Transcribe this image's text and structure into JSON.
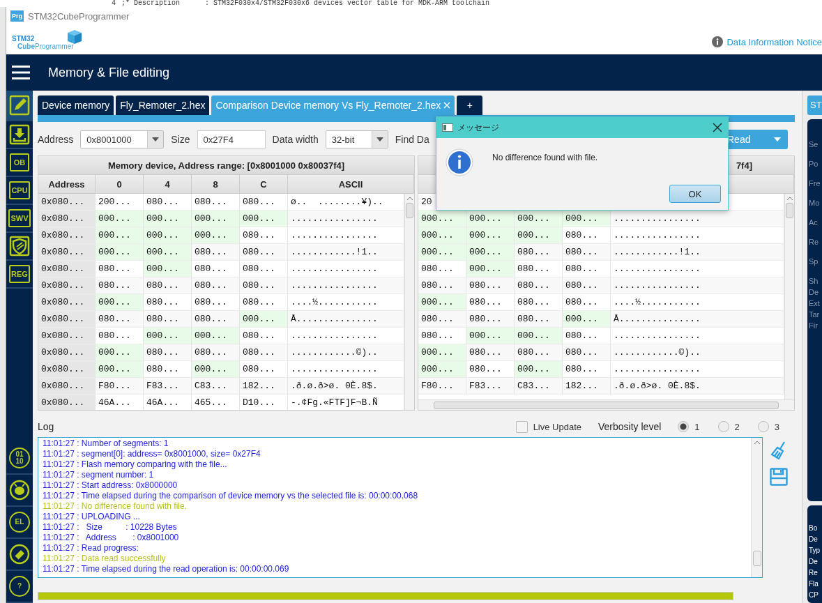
{
  "background_editor": {
    "line_number": "4",
    "text": ";* Description      : STM32F030x4/STM32F030x6 devices vector table for MDK-ARM toolchain"
  },
  "window": {
    "title": "STM32CubeProgrammer",
    "app_icon_label": "Prg"
  },
  "logo": {
    "brand": "STM32",
    "product": "**Cube**Programmer"
  },
  "notice_link": "Data Information Notice",
  "header": {
    "title": "Memory & File editing"
  },
  "sidebar": {
    "top_items": [
      {
        "kind": "edit",
        "selected": true
      },
      {
        "kind": "download",
        "selected": false
      },
      {
        "kind": "tag",
        "lines": [
          "OB"
        ],
        "selected": false
      },
      {
        "kind": "tag",
        "lines": [
          "CPU"
        ],
        "selected": false
      },
      {
        "kind": "tag",
        "lines": [
          "SWV"
        ],
        "selected": false
      },
      {
        "kind": "shield",
        "selected": false
      },
      {
        "kind": "tag",
        "lines": [
          "REG"
        ],
        "selected": false
      }
    ],
    "bottom_items": [
      {
        "kind": "circle",
        "lines": [
          "01",
          "10"
        ],
        "selected": false
      },
      {
        "kind": "bug",
        "selected": false
      },
      {
        "kind": "circle",
        "lines": [
          "EL"
        ],
        "selected": false
      },
      {
        "kind": "eraser",
        "selected": false
      },
      {
        "kind": "circle",
        "lines": [
          "?"
        ],
        "selected": false
      }
    ]
  },
  "tabs": [
    {
      "label": "Device memory",
      "selected": false,
      "closable": false
    },
    {
      "label": "Fly_Remoter_2.hex",
      "selected": false,
      "closable": false
    },
    {
      "label": "Comparison Device memory Vs Fly_Remoter_2.hex",
      "selected": true,
      "closable": true
    }
  ],
  "add_tab_label": "+",
  "toolbar": {
    "address_label": "Address",
    "address_value": "0x8001000",
    "size_label": "Size",
    "size_value": "0x27F4",
    "data_width_label": "Data width",
    "data_width_value": "32-bit",
    "find_label": "Find Da",
    "read_button": "Read"
  },
  "tables": [
    {
      "title": "Memory device, Address range: [0x8001000 0x80037f4]",
      "columns": [
        "Address",
        "0",
        "4",
        "8",
        "C",
        "ASCII"
      ],
      "rows": [
        {
          "address": "0x080...",
          "values": [
            "200...",
            "080...",
            "080...",
            "080..."
          ],
          "highlighted": [
            false,
            false,
            false,
            false
          ],
          "ascii": "ø..  ........¥).."
        },
        {
          "address": "0x080...",
          "values": [
            "000...",
            "000...",
            "000...",
            "000..."
          ],
          "highlighted": [
            true,
            true,
            true,
            true
          ],
          "ascii": "................"
        },
        {
          "address": "0x080...",
          "values": [
            "000...",
            "000...",
            "000...",
            "080..."
          ],
          "highlighted": [
            true,
            true,
            true,
            false
          ],
          "ascii": "................"
        },
        {
          "address": "0x080...",
          "values": [
            "000...",
            "000...",
            "080...",
            "080..."
          ],
          "highlighted": [
            true,
            true,
            false,
            false
          ],
          "ascii": "............!1.."
        },
        {
          "address": "0x080...",
          "values": [
            "080...",
            "000...",
            "080...",
            "080..."
          ],
          "highlighted": [
            false,
            true,
            false,
            false
          ],
          "ascii": "................"
        },
        {
          "address": "0x080...",
          "values": [
            "080...",
            "080...",
            "080...",
            "080..."
          ],
          "highlighted": [
            false,
            false,
            false,
            false
          ],
          "ascii": "................"
        },
        {
          "address": "0x080...",
          "values": [
            "000...",
            "080...",
            "080...",
            "080..."
          ],
          "highlighted": [
            true,
            false,
            false,
            false
          ],
          "ascii": "....½..........."
        },
        {
          "address": "0x080...",
          "values": [
            "080...",
            "080...",
            "080...",
            "000..."
          ],
          "highlighted": [
            false,
            false,
            false,
            true
          ],
          "ascii": "Å..............."
        },
        {
          "address": "0x080...",
          "values": [
            "080...",
            "000...",
            "000...",
            "080..."
          ],
          "highlighted": [
            false,
            true,
            true,
            false
          ],
          "ascii": "................"
        },
        {
          "address": "0x080...",
          "values": [
            "000...",
            "080...",
            "080...",
            "080..."
          ],
          "highlighted": [
            true,
            false,
            false,
            false
          ],
          "ascii": "............©).."
        },
        {
          "address": "0x080...",
          "values": [
            "000...",
            "080...",
            "000...",
            "080..."
          ],
          "highlighted": [
            true,
            false,
            true,
            false
          ],
          "ascii": "................"
        },
        {
          "address": "0x080...",
          "values": [
            "F80...",
            "F83...",
            "C83...",
            "182..."
          ],
          "highlighted": [
            false,
            false,
            false,
            false
          ],
          "ascii": ".ð.ø.ð>ø. 0È.8$."
        },
        {
          "address": "0x080...",
          "values": [
            "46A...",
            "46A...",
            "465...",
            "D10..."
          ],
          "highlighted": [
            false,
            false,
            false,
            false
          ],
          "ascii": "-.¢Fg.«FTF]F¬B.Ñ"
        }
      ]
    },
    {
      "title": "7f4]",
      "rows": [
        {
          "values": [
            "20"
          ],
          "highlighted": [
            false
          ]
        },
        {
          "values": [
            "000...",
            "000...",
            "000...",
            "000..."
          ],
          "highlighted": [
            true,
            true,
            true,
            true
          ],
          "ascii": "................"
        },
        {
          "values": [
            "000...",
            "000...",
            "000...",
            "080..."
          ],
          "highlighted": [
            true,
            true,
            true,
            false
          ],
          "ascii": "................"
        },
        {
          "values": [
            "000...",
            "000...",
            "080...",
            "080..."
          ],
          "highlighted": [
            true,
            true,
            false,
            false
          ],
          "ascii": "............!1.."
        },
        {
          "values": [
            "080...",
            "000...",
            "080...",
            "080..."
          ],
          "highlighted": [
            false,
            true,
            false,
            false
          ],
          "ascii": "................"
        },
        {
          "values": [
            "080...",
            "080...",
            "080...",
            "080..."
          ],
          "highlighted": [
            false,
            false,
            false,
            false
          ],
          "ascii": "................"
        },
        {
          "values": [
            "000...",
            "080...",
            "080...",
            "080..."
          ],
          "highlighted": [
            true,
            false,
            false,
            false
          ],
          "ascii": "....½..........."
        },
        {
          "values": [
            "080...",
            "080...",
            "080...",
            "000..."
          ],
          "highlighted": [
            false,
            false,
            false,
            true
          ],
          "ascii": "Å..............."
        },
        {
          "values": [
            "080...",
            "000...",
            "000...",
            "080..."
          ],
          "highlighted": [
            false,
            true,
            true,
            false
          ],
          "ascii": "................"
        },
        {
          "values": [
            "000...",
            "080...",
            "080...",
            "080..."
          ],
          "highlighted": [
            true,
            false,
            false,
            false
          ],
          "ascii": "............©).."
        },
        {
          "values": [
            "000...",
            "080...",
            "000...",
            "080..."
          ],
          "highlighted": [
            true,
            false,
            true,
            false
          ],
          "ascii": "................"
        },
        {
          "values": [
            "F80...",
            "F83...",
            "C83...",
            "182..."
          ],
          "highlighted": [
            false,
            false,
            false,
            false
          ],
          "ascii": ".ð.ø.ð>ø. 0È.8$."
        }
      ]
    }
  ],
  "log": {
    "title": "Log",
    "live_update": {
      "label": "Live Update",
      "checked": false
    },
    "verbosity": {
      "label": "Verbosity level",
      "options": [
        {
          "label": "1",
          "selected": true
        },
        {
          "label": "2",
          "selected": false
        },
        {
          "label": "3",
          "selected": false
        }
      ]
    },
    "lines": [
      {
        "kind": "info",
        "text": "11:01:27 : Number of segments: 1"
      },
      {
        "kind": "info",
        "text": "11:01:27 : segment[0]: address= 0x8001000, size= 0x27F4"
      },
      {
        "kind": "info",
        "text": "11:01:27 : Flash memory comparing with the file..."
      },
      {
        "kind": "info",
        "text": "11:01:27 : segment number: 1"
      },
      {
        "kind": "info",
        "text": "11:01:27 : Start address: 0x8000000"
      },
      {
        "kind": "info",
        "text": "11:01:27 : Time elapsed during the comparison of device memory vs the selected file is: 00:00:00.068"
      },
      {
        "kind": "success",
        "text": "11:01:27 : No difference found with file."
      },
      {
        "kind": "info",
        "text": "11:01:27 : UPLOADING ..."
      },
      {
        "kind": "info",
        "text": "11:01:27 :   Size          : 10228 Bytes"
      },
      {
        "kind": "info",
        "text": "11:01:27 :   Address       : 0x8001000"
      },
      {
        "kind": "info",
        "text": "11:01:27 : Read progress:"
      },
      {
        "kind": "success",
        "text": "11:01:27 : Data read successfully"
      },
      {
        "kind": "info",
        "text": "11:01:27 : Time elapsed during the read operation is: 00:00:00.069"
      }
    ]
  },
  "progress": {
    "level": 1
  },
  "right_panel": {
    "button": "ST",
    "upper_card_items": [
      "Se",
      "Po",
      "Fre",
      "Mo",
      "Ac",
      "Re",
      "Sp",
      "Sh",
      "De",
      "Ext",
      "Tar",
      "Fir"
    ],
    "lower_card_items": [
      "Bo",
      "De",
      "Typ",
      "De",
      "Re",
      "Fla",
      "CP"
    ]
  },
  "dialog": {
    "title": "メッセージ",
    "message": "No difference found with file.",
    "ok_button": "OK"
  }
}
